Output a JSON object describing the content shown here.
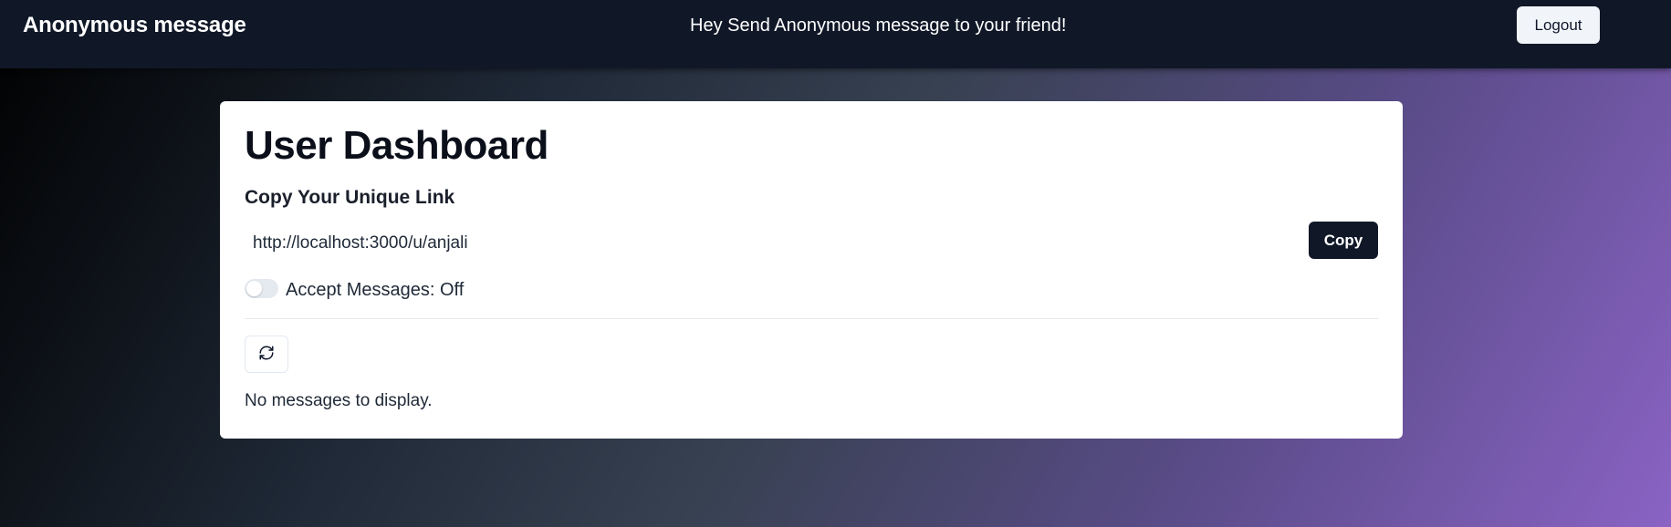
{
  "navbar": {
    "brand": "Anonymous message",
    "tagline": "Hey Send Anonymous message to your friend!",
    "logout_label": "Logout"
  },
  "dashboard": {
    "title": "User Dashboard",
    "link_heading": "Copy Your Unique Link",
    "link_value": "http://localhost:3000/u/anjali",
    "copy_label": "Copy",
    "accept_messages_label": "Accept Messages: Off",
    "accept_messages_enabled": false,
    "refresh_icon": "refresh-icon",
    "empty_state": "No messages to display."
  },
  "colors": {
    "navbar_bg": "#101828",
    "primary_button": "#101828",
    "card_bg": "#ffffff",
    "gradient_end": "#8a63c4"
  }
}
